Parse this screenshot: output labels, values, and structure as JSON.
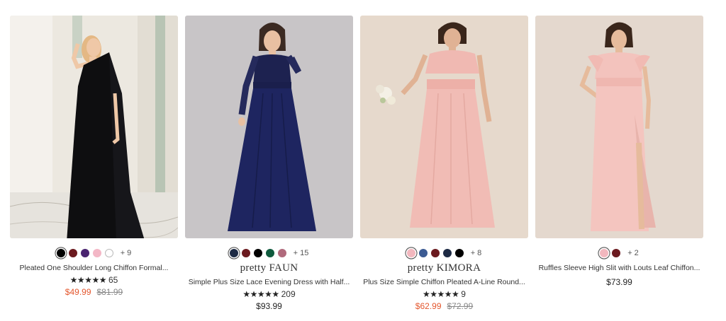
{
  "products": [
    {
      "brand": "",
      "title": "Pleated One Shoulder Long Chiffon Formal...",
      "swatches": [
        "#000000",
        "#6b1a1f",
        "#4a2470",
        "#f3b7c6",
        "#ffffff"
      ],
      "more": "+ 9",
      "stars": "★★★★★",
      "reviews": "65",
      "sale_price": "$49.99",
      "old_price": "$81.99",
      "price": ""
    },
    {
      "brand": "pretty FAUN",
      "title": "Simple Plus Size Lace Evening Dress with Half...",
      "swatches": [
        "#1d2a44",
        "#6b1a1f",
        "#000000",
        "#0f5a3d",
        "#b06a7c"
      ],
      "more": "+ 15",
      "stars": "★★★★★",
      "reviews": "209",
      "sale_price": "",
      "old_price": "",
      "price": "$93.99"
    },
    {
      "brand": "pretty KIMORA",
      "title": "Plus Size Simple Chiffon Pleated A-Line Round...",
      "swatches": [
        "#f2b7be",
        "#3c5b93",
        "#6b1a1f",
        "#1d2a44",
        "#000000"
      ],
      "more": "+ 8",
      "stars": "★★★★★",
      "reviews": "9",
      "sale_price": "$62.99",
      "old_price": "$72.99",
      "price": ""
    },
    {
      "brand": "",
      "title": "Ruffles Sleeve High Slit with Louts Leaf Chiffon...",
      "swatches": [
        "#f2b7be",
        "#6b1a1f"
      ],
      "more": "+ 2",
      "stars": "",
      "reviews": "",
      "sale_price": "",
      "old_price": "",
      "price": "$73.99"
    }
  ]
}
